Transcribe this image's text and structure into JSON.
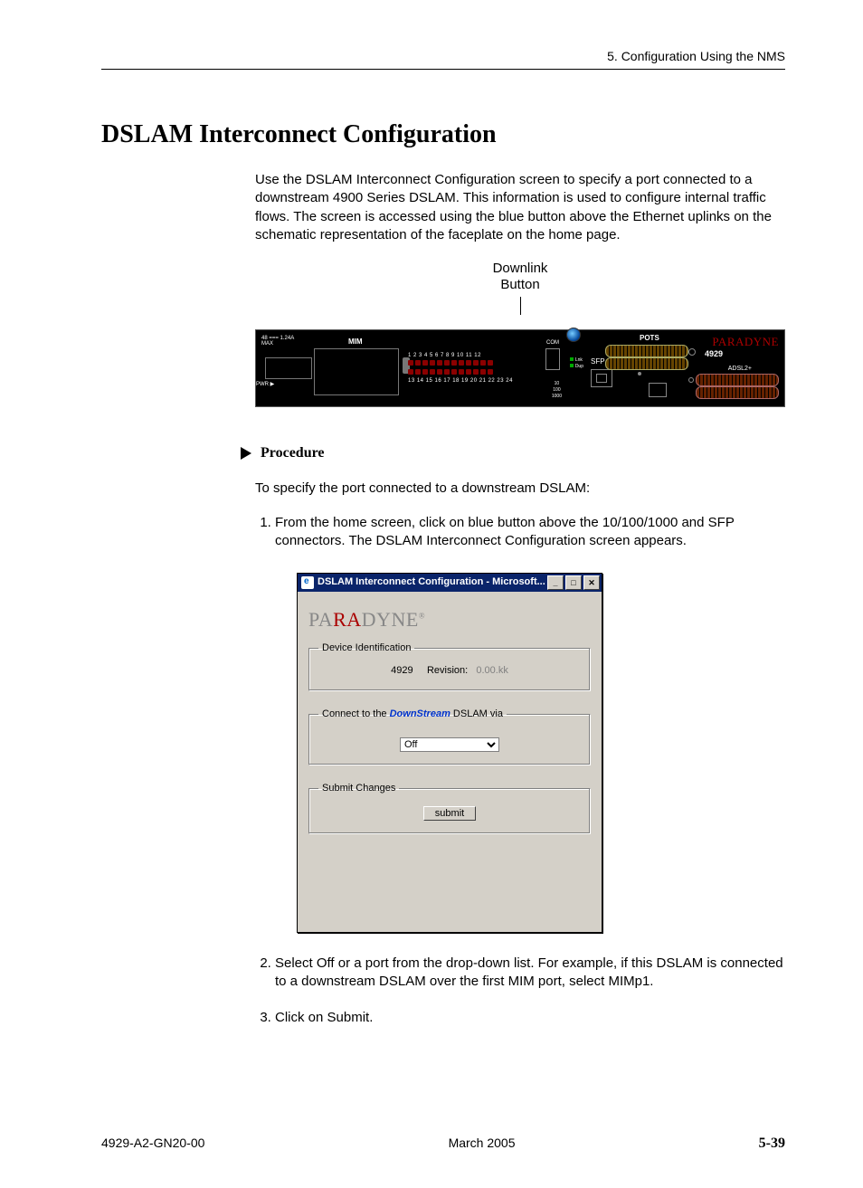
{
  "header": {
    "chapter": "5. Configuration Using the NMS"
  },
  "title": "DSLAM Interconnect Configuration",
  "intro": "Use the DSLAM Interconnect Configuration screen to specify a port connected to a downstream 4900 Series DSLAM. This information is used to configure internal traffic flows. The screen is accessed using the blue button above the Ethernet uplinks on the schematic representation of the faceplate on the home page.",
  "callout": {
    "line1": "Downlink",
    "line2": "Button"
  },
  "faceplate": {
    "power_spec": "48 === 1.24A",
    "max": "MAX",
    "pwr": "PWR ▶",
    "mim": "MIM",
    "top_nums": "1  2  3  4  5  6  7  8  9 10 11 12",
    "bot_nums": "13 14 15 16 17 18 19 20 21 22 23 24",
    "com": "COM",
    "speed": "10\n100\n1000",
    "lnk": "Lnk",
    "dup": "Dup",
    "sfp": "SFP",
    "pots": "POTS",
    "brand_pa": "PA",
    "brand_ra": "RA",
    "brand_dyne": "DYNE",
    "model": "4929",
    "adsl": "ADSL2+"
  },
  "procedure": {
    "label": "Procedure",
    "lead": "To specify the port connected to a downstream DSLAM:",
    "steps": [
      "From the home screen, click on blue button above the 10/100/1000 and SFP connectors. The DSLAM Interconnect Configuration screen appears.",
      "Select Off or a port from the drop-down list. For example, if this DSLAM is connected to a downstream DSLAM over the first MIM port, select MIMp1.",
      "Click on Submit."
    ]
  },
  "window": {
    "title": "DSLAM Interconnect Configuration - Microsoft...",
    "brand": {
      "pa": "PA",
      "ra": "RA",
      "dyne": "DYNE",
      "reg": "®"
    },
    "group1": {
      "legend": "Device Identification",
      "model": "4929",
      "rev_label": "Revision:",
      "rev_value": "0.00.kk"
    },
    "group2": {
      "legend_pre": "Connect to the ",
      "legend_em": "DownStream",
      "legend_post": " DSLAM via",
      "selected": "Off"
    },
    "group3": {
      "legend": "Submit Changes",
      "button": "submit"
    },
    "controls": {
      "min": "_",
      "max": "□",
      "close": "✕"
    }
  },
  "footer": {
    "left": "4929-A2-GN20-00",
    "center": "March 2005",
    "right": "5-39"
  }
}
